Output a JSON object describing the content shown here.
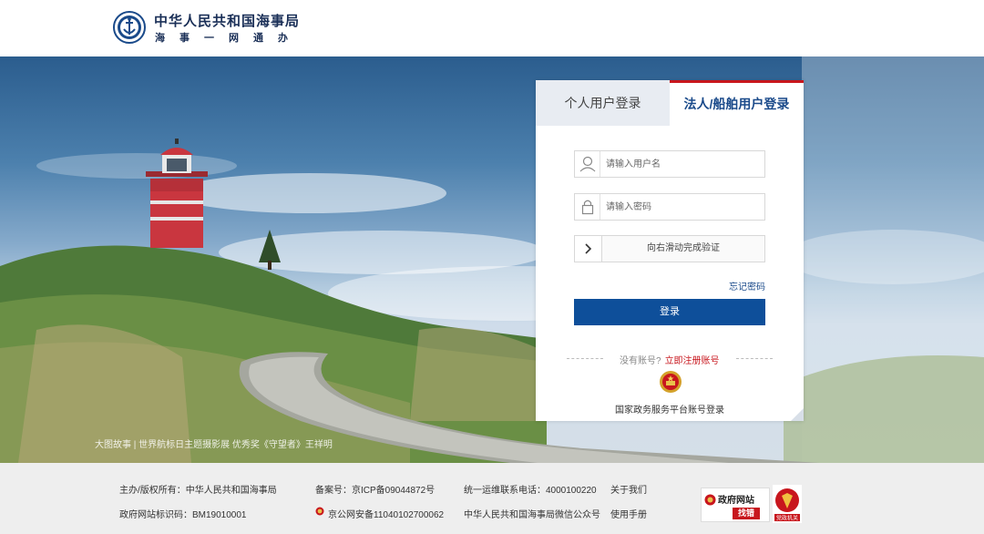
{
  "header": {
    "title": "中华人民共和国海事局",
    "subtitle": "海事一网通办"
  },
  "hero": {
    "caption": "大图故事 | 世界航标日主题摄影展 优秀奖《守望者》王祥明"
  },
  "login": {
    "tabs": [
      {
        "label": "个人用户登录",
        "active": false
      },
      {
        "label": "法人/船舶用户登录",
        "active": true
      }
    ],
    "username_placeholder": "请输入用户名",
    "password_placeholder": "请输入密码",
    "slider_text": "向右滑动完成验证",
    "forgot_label": "忘记密码",
    "login_button": "登录",
    "no_account_text": "没有账号?",
    "register_link": "立即注册账号",
    "gov_login_label": "国家政务服务平台账号登录"
  },
  "footer": {
    "owner": "主办/版权所有：中华人民共和国海事局",
    "icp": "备案号：京ICP备09044872号",
    "hotline": "统一运维联系电话：4000100220",
    "about": "关于我们",
    "site_code": "政府网站标识码：BM19010001",
    "police": "京公网安备11040102700062",
    "wechat": "中华人民共和国海事局微信公众号",
    "manual": "使用手册",
    "badge_top": "政府网站",
    "badge_bottom": "找错",
    "badge_party": "党政机关"
  },
  "colors": {
    "brand_navy": "#1a2f57",
    "primary_blue": "#0e4f9a",
    "accent_red": "#c8161d",
    "footer_bg": "#eeeeee"
  },
  "icons": [
    "msa-emblem-icon",
    "user-icon",
    "lock-icon",
    "chevron-right-icon",
    "national-emblem-icon",
    "police-badge-icon"
  ]
}
